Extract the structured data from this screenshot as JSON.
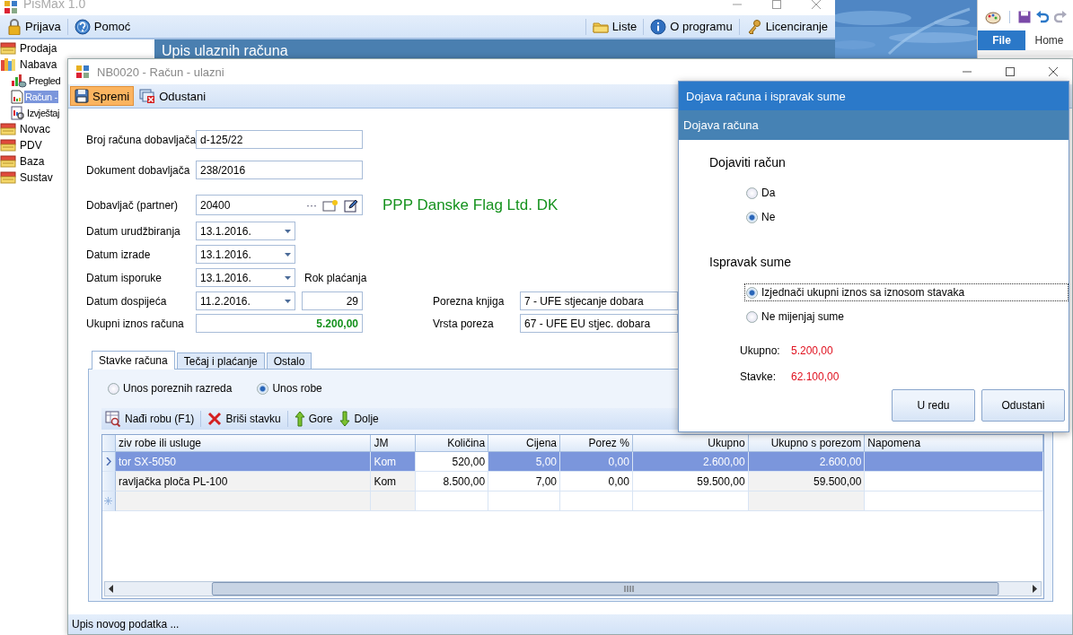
{
  "app": {
    "title": "PisMax 1.0",
    "toolbar_left": [
      {
        "label": "Prijava"
      },
      {
        "label": "Pomoć"
      }
    ],
    "toolbar_right": [
      {
        "label": "Liste"
      },
      {
        "label": "O programu"
      },
      {
        "label": "Licenciranje"
      }
    ],
    "sidebar": [
      {
        "label": "Prodaja",
        "selected": false
      },
      {
        "label": "Nabava",
        "selected": false,
        "children": [
          {
            "label": "Pregled",
            "selected": false
          },
          {
            "label": "Račun -",
            "selected": true
          },
          {
            "label": "Izvještaj",
            "selected": false
          }
        ]
      },
      {
        "label": "Novac",
        "selected": false
      },
      {
        "label": "PDV",
        "selected": false
      },
      {
        "label": "Baza",
        "selected": false
      },
      {
        "label": "Sustav",
        "selected": false
      }
    ],
    "header": "Upis ulaznih računa"
  },
  "word": {
    "tabs": [
      {
        "label": "File",
        "selected": true
      },
      {
        "label": "Home",
        "selected": false
      }
    ]
  },
  "invoice": {
    "title": "NB0020 - Račun - ulazni",
    "toolbar": [
      {
        "label": "Spremi",
        "selected": true
      },
      {
        "label": "Odustani",
        "selected": false
      }
    ],
    "form": [
      {
        "kind": "text",
        "label": "Broj računa dobavljača",
        "value": "d-125/22"
      },
      {
        "kind": "text",
        "label": "Dokument dobavljača",
        "value": "238/2016"
      },
      {
        "kind": "partner",
        "label": "Dobavljač (partner)",
        "value": "20400",
        "browse": "···",
        "partner_name": "PPP Danske Flag Ltd. DK"
      },
      {
        "kind": "date",
        "label": "Datum urudžbiranja",
        "value": "13.1.2016."
      },
      {
        "kind": "date",
        "label": "Datum izrade",
        "value": "13.1.2016."
      },
      {
        "kind": "date",
        "label": "Datum isporuke",
        "value": "13.1.2016.",
        "note": "Rok plaćanja"
      },
      {
        "kind": "date",
        "label": "Datum dospijeća",
        "value": "11.2.2016.",
        "term": "29",
        "tax": {
          "label": "Porezna knjiga",
          "value": "7 - UFE stjecanje dobara"
        }
      },
      {
        "kind": "total",
        "label": "Ukupni iznos računa",
        "value": "5.200,00",
        "tax": {
          "label": "Vrsta poreza",
          "value": "67 - UFE EU stjec. dobara"
        }
      }
    ],
    "tabs": [
      {
        "label": "Stavke računa",
        "selected": true
      },
      {
        "label": "Tečaj i plaćanje",
        "selected": false
      },
      {
        "label": "Ostalo",
        "selected": false
      }
    ],
    "entry_mode": [
      {
        "label": "Unos poreznih razreda",
        "selected": false
      },
      {
        "label": "Unos robe",
        "selected": true
      }
    ],
    "grid_toolbar": [
      {
        "label": "Nađi robu (F1)"
      },
      {
        "label": "Briši stavku"
      },
      {
        "label": "Gore"
      },
      {
        "label": "Dolje"
      }
    ],
    "table": {
      "columns": [
        {
          "label": "ziv robe ili usluge",
          "readonly": true
        },
        {
          "label": "JM",
          "readonly": true
        },
        {
          "label": "Količina",
          "readonly": false
        },
        {
          "label": "Cijena",
          "readonly": false
        },
        {
          "label": "Porez %",
          "readonly": false
        },
        {
          "label": "Ukupno",
          "readonly": false
        },
        {
          "label": "Ukupno s porezom",
          "readonly": true
        },
        {
          "label": "Napomena",
          "readonly": false
        }
      ],
      "rows": [
        {
          "kind": "item",
          "selected": true,
          "cells": [
            {
              "text": "tor SX-5050",
              "focused": false
            },
            {
              "text": "Kom",
              "focused": false
            },
            {
              "text": "520,00",
              "focused": true
            },
            {
              "text": "5,00",
              "focused": false
            },
            {
              "text": "0,00",
              "focused": false
            },
            {
              "text": "2.600,00",
              "focused": false
            },
            {
              "text": "2.600,00",
              "focused": false
            }
          ]
        },
        {
          "kind": "item",
          "selected": false,
          "cells": [
            {
              "text": "ravljačka ploča PL-100",
              "focused": false
            },
            {
              "text": "Kom",
              "focused": false
            },
            {
              "text": "8.500,00",
              "focused": false
            },
            {
              "text": "7,00",
              "focused": false
            },
            {
              "text": "0,00",
              "focused": false
            },
            {
              "text": "59.500,00",
              "focused": false
            },
            {
              "text": "59.500,00",
              "focused": false
            }
          ]
        },
        {
          "kind": "new",
          "selected": false
        }
      ]
    },
    "status": "Upis novog podatka ..."
  },
  "dialog": {
    "title": "Dojava računa i ispravak sume",
    "header": "Dojava računa",
    "sections": [
      {
        "title": "Dojaviti račun",
        "options": [
          {
            "label": "Da",
            "selected": false,
            "focused": false
          },
          {
            "label": "Ne",
            "selected": true,
            "focused": false
          }
        ]
      },
      {
        "title": "Ispravak sume",
        "options": [
          {
            "label": "Izjednači ukupni iznos sa iznosom stavaka",
            "selected": true,
            "focused": true
          },
          {
            "label": "Ne mijenjaj sume",
            "selected": false,
            "focused": false
          }
        ]
      }
    ],
    "sums": [
      {
        "label": "Ukupno:",
        "value": "5.200,00"
      },
      {
        "label": "Stavke:",
        "value": "62.100,00"
      }
    ],
    "buttons": [
      {
        "label": "U redu"
      },
      {
        "label": "Odustani"
      }
    ]
  }
}
